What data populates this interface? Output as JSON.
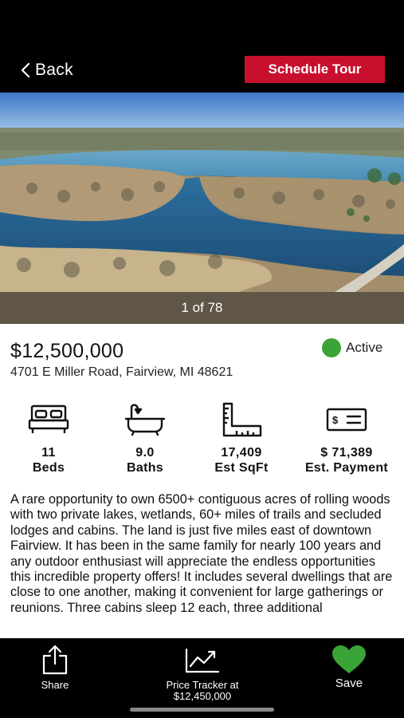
{
  "header": {
    "back_label": "Back",
    "schedule_label": "Schedule Tour",
    "accent_color": "#c8102e"
  },
  "gallery": {
    "counter": "1 of 78"
  },
  "listing": {
    "price": "$12,500,000",
    "status": "Active",
    "status_color": "#3aa437",
    "address": "4701 E Miller Road, Fairview, MI 48621",
    "stats": [
      {
        "icon": "bed-icon",
        "value": "11",
        "label": "Beds"
      },
      {
        "icon": "bathtub-icon",
        "value": "9.0",
        "label": "Baths"
      },
      {
        "icon": "ruler-icon",
        "value": "17,409",
        "label": "Est SqFt"
      },
      {
        "icon": "check-payment-icon",
        "value": "$ 71,389",
        "label": "Est. Payment"
      }
    ],
    "description": "A rare opportunity to own 6500+ contiguous acres of rolling woods with two private lakes, wetlands, 60+ miles of trails and secluded lodges and cabins. The land is just five miles east of downtown Fairview. It has been in the same family for nearly 100 years and any outdoor enthusiast will appreciate the endless opportunities this incredible property offers! It includes several dwellings that are close to one another, making it convenient for large gatherings or reunions. Three cabins sleep 12 each, three additional"
  },
  "bottom_bar": {
    "share_label": "Share",
    "tracker_label_line1": "Price Tracker at",
    "tracker_label_line2": "$12,450,000",
    "save_label": "Save",
    "save_color": "#3aa437"
  }
}
